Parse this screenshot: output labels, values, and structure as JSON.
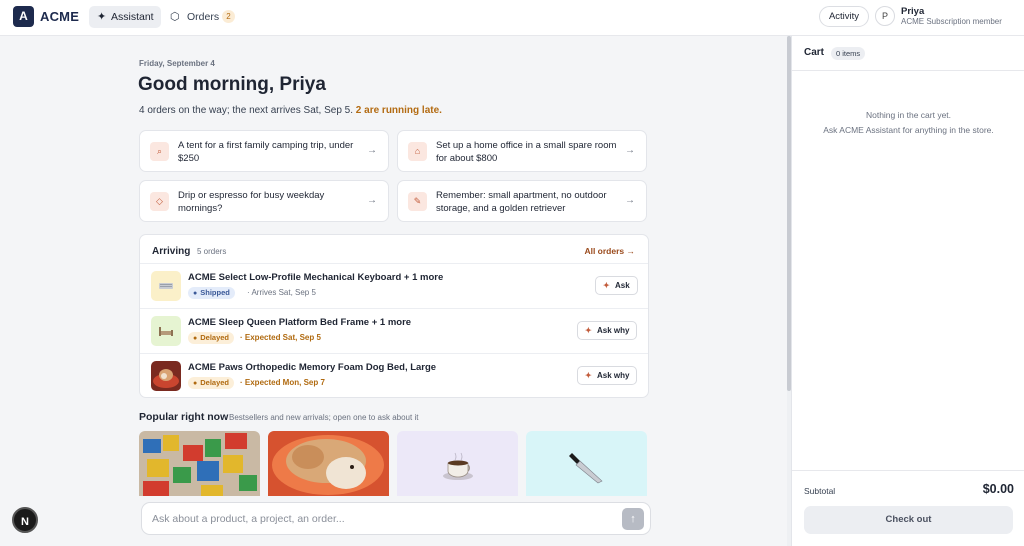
{
  "header": {
    "logo_letter": "A",
    "brand": "ACME",
    "tabs": [
      {
        "label": "Assistant",
        "icon": "sparkle-icon"
      },
      {
        "label": "Orders",
        "icon": "box-icon",
        "badge": "2"
      }
    ],
    "activity_label": "Activity",
    "user": {
      "initial": "P",
      "name": "Priya",
      "subtitle": "ACME Subscription member"
    }
  },
  "main": {
    "date": "Friday, September 4",
    "greeting": "Good morning, Priya",
    "summary": "4 orders on the way; the next arrives Sat, Sep 5.",
    "summary_late": "2 are running late.",
    "prompts": [
      {
        "text": "A tent for a first family camping trip, under $250",
        "icon": "search-icon"
      },
      {
        "text": "Set up a home office in a small spare room for about $800",
        "icon": "home-icon"
      },
      {
        "text": "Drip or espresso for busy weekday mornings?",
        "icon": "tag-icon"
      },
      {
        "text": "Remember: small apartment, no outdoor storage, and a golden retriever",
        "icon": "pencil-icon"
      }
    ],
    "arriving": {
      "title": "Arriving",
      "count": "5 orders",
      "all_orders": "All orders",
      "orders": [
        {
          "name": "ACME Select Low-Profile Mechanical Keyboard + 1 more",
          "status": "Shipped",
          "date": "Arrives Sat, Sep 5",
          "action": "Ask"
        },
        {
          "name": "ACME Sleep Queen Platform Bed Frame + 1 more",
          "status": "Delayed",
          "date": "Expected Sat, Sep 5",
          "action": "Ask why"
        },
        {
          "name": "ACME Paws Orthopedic Memory Foam Dog Bed, Large",
          "status": "Delayed",
          "date": "Expected Mon, Sep 7",
          "action": "Ask why"
        }
      ]
    },
    "popular": {
      "title": "Popular right now",
      "subtitle": "Bestsellers and new arrivals; open one to ask about it"
    },
    "ask_placeholder": "Ask about a product, a project, an order...",
    "n_badge": "N"
  },
  "cart": {
    "title": "Cart",
    "count": "0 items",
    "empty_line1": "Nothing in the cart yet.",
    "empty_line2": "Ask ACME Assistant for anything in the store.",
    "subtotal_label": "Subtotal",
    "subtotal_value": "$0.00",
    "checkout_label": "Check out"
  },
  "colors": {
    "brand_navy": "#1d2a4d",
    "late_amber": "#b36b12",
    "shipped_blue": "#3b5998",
    "accent_terracotta": "#c25b3a"
  }
}
